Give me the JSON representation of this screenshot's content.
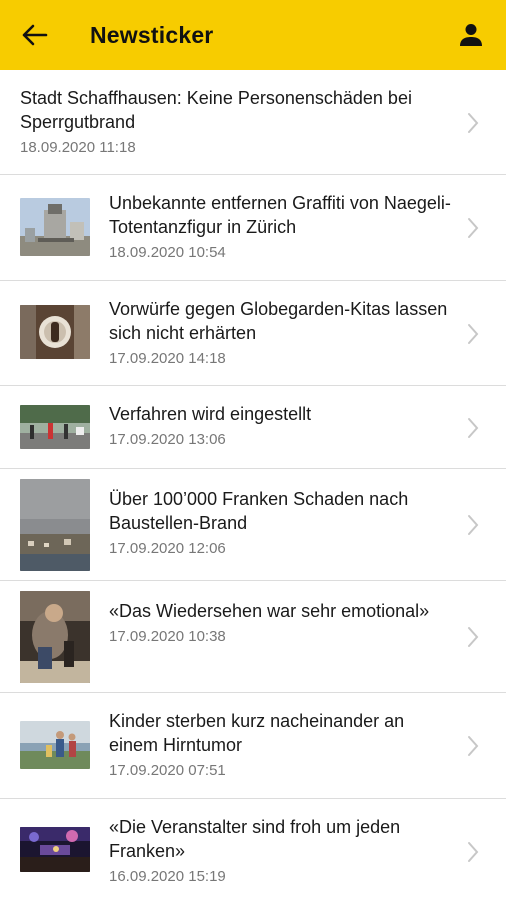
{
  "header": {
    "title": "Newsticker",
    "back_icon": "arrow-left-icon",
    "account_icon": "person-icon",
    "background": "#f7cc00"
  },
  "articles": [
    {
      "headline": "Stadt Schaffhausen: Keine Personenschäden bei Sperrgutbrand",
      "date": "18.09.2020 11:18",
      "thumbnail": "none"
    },
    {
      "headline": "Unbekannte entfernen Graffiti von Naegeli-Totentanzfigur in Zürich",
      "date": "18.09.2020 10:54",
      "thumbnail": "monument-photo"
    },
    {
      "headline": "Vorwürfe gegen Globegarden-Kitas lassen sich nicht erhärten",
      "date": "17.09.2020 14:18",
      "thumbnail": "sign-photo"
    },
    {
      "headline": "Verfahren wird eingestellt",
      "date": "17.09.2020 13:06",
      "thumbnail": "street-photo"
    },
    {
      "headline": "Über 100’000 Franken Schaden nach Baustellen-Brand",
      "date": "17.09.2020 12:06",
      "thumbnail": "smoke-photo"
    },
    {
      "headline": "«Das Wiedersehen war sehr emotional»",
      "date": "17.09.2020 10:38",
      "thumbnail": "hug-photo"
    },
    {
      "headline": "Kinder sterben kurz nacheinander an einem Hirntumor",
      "date": "17.09.2020 07:51",
      "thumbnail": "family-photo"
    },
    {
      "headline": "«Die Veranstalter sind froh um jeden Franken»",
      "date": "16.09.2020 15:19",
      "thumbnail": "stage-photo"
    }
  ]
}
